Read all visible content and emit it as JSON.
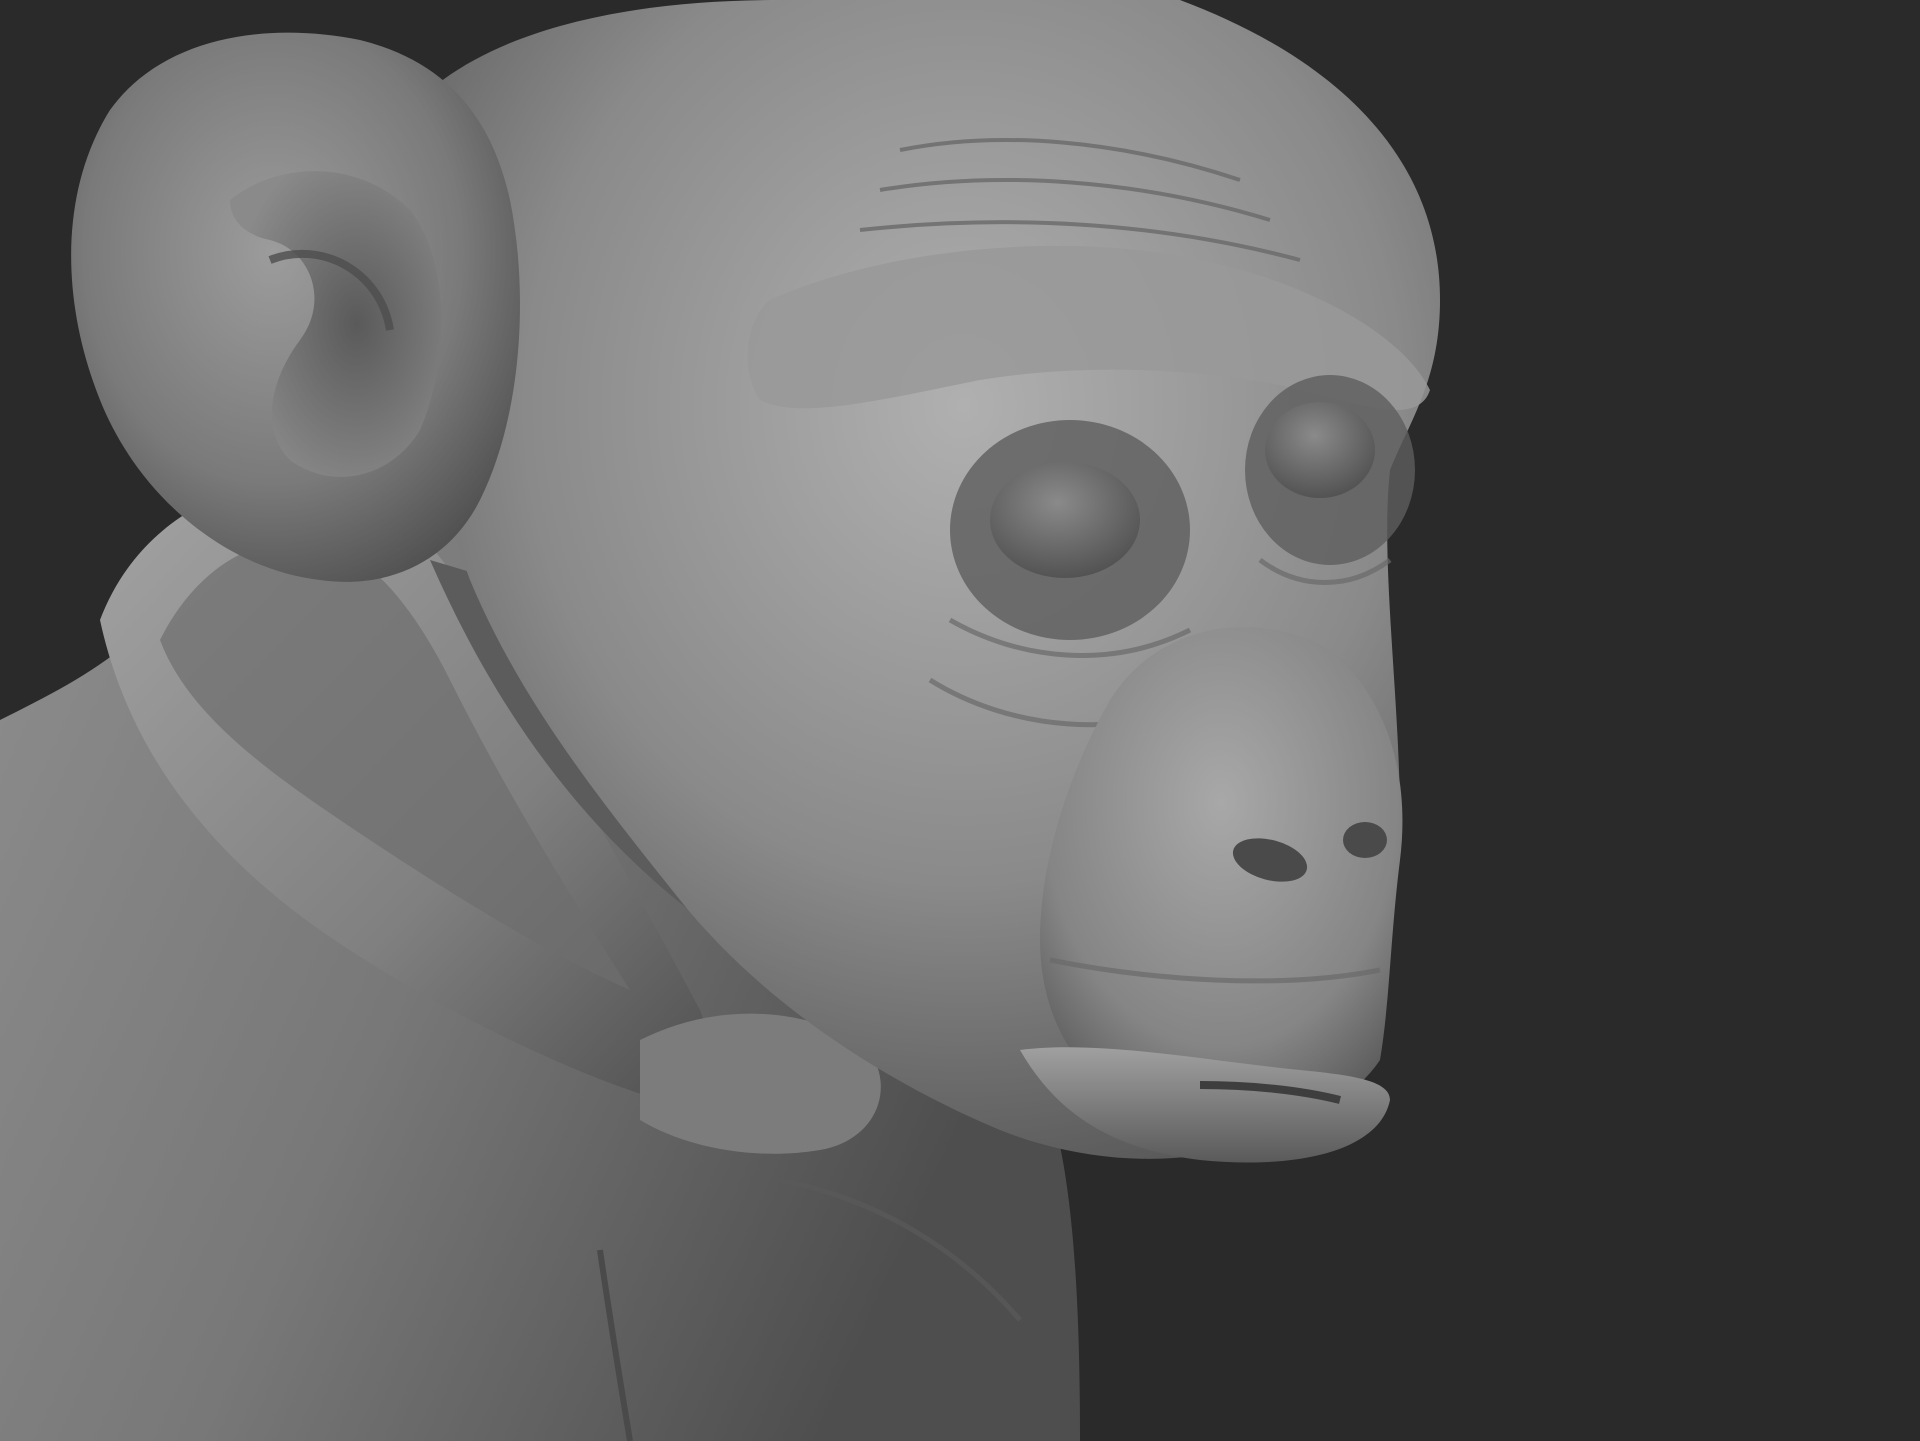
{
  "scene": {
    "subject": "chimpanzee-bust-sculpt",
    "background_color": "#2a2a2a",
    "clay_color": "#8c8c8c",
    "clay_highlight": "#b3b3b3",
    "clay_shadow": "#4a4a4a",
    "eye_color": "#6e6e6e"
  }
}
